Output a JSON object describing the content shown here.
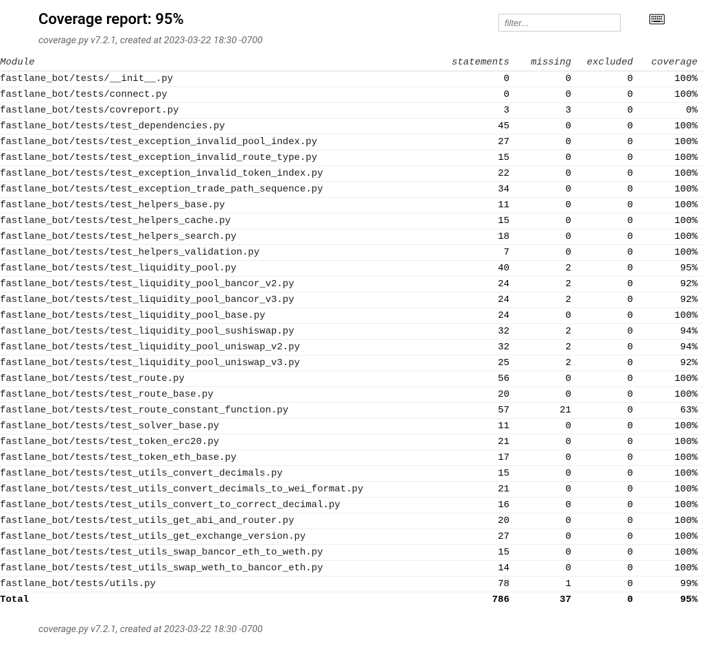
{
  "header": {
    "title_prefix": "Coverage report:",
    "title_pct": "95%",
    "subtitle": "coverage.py v7.2.1, created at 2023-03-22 18:30 -0700",
    "filter_placeholder": "filter..."
  },
  "columns": {
    "module": "Module",
    "statements": "statements",
    "missing": "missing",
    "excluded": "excluded",
    "coverage": "coverage"
  },
  "rows": [
    {
      "name": "fastlane_bot/tests/__init__.py",
      "stmts": "0",
      "miss": "0",
      "excl": "0",
      "cov": "100%"
    },
    {
      "name": "fastlane_bot/tests/connect.py",
      "stmts": "0",
      "miss": "0",
      "excl": "0",
      "cov": "100%"
    },
    {
      "name": "fastlane_bot/tests/covreport.py",
      "stmts": "3",
      "miss": "3",
      "excl": "0",
      "cov": "0%"
    },
    {
      "name": "fastlane_bot/tests/test_dependencies.py",
      "stmts": "45",
      "miss": "0",
      "excl": "0",
      "cov": "100%"
    },
    {
      "name": "fastlane_bot/tests/test_exception_invalid_pool_index.py",
      "stmts": "27",
      "miss": "0",
      "excl": "0",
      "cov": "100%"
    },
    {
      "name": "fastlane_bot/tests/test_exception_invalid_route_type.py",
      "stmts": "15",
      "miss": "0",
      "excl": "0",
      "cov": "100%"
    },
    {
      "name": "fastlane_bot/tests/test_exception_invalid_token_index.py",
      "stmts": "22",
      "miss": "0",
      "excl": "0",
      "cov": "100%"
    },
    {
      "name": "fastlane_bot/tests/test_exception_trade_path_sequence.py",
      "stmts": "34",
      "miss": "0",
      "excl": "0",
      "cov": "100%"
    },
    {
      "name": "fastlane_bot/tests/test_helpers_base.py",
      "stmts": "11",
      "miss": "0",
      "excl": "0",
      "cov": "100%"
    },
    {
      "name": "fastlane_bot/tests/test_helpers_cache.py",
      "stmts": "15",
      "miss": "0",
      "excl": "0",
      "cov": "100%"
    },
    {
      "name": "fastlane_bot/tests/test_helpers_search.py",
      "stmts": "18",
      "miss": "0",
      "excl": "0",
      "cov": "100%"
    },
    {
      "name": "fastlane_bot/tests/test_helpers_validation.py",
      "stmts": "7",
      "miss": "0",
      "excl": "0",
      "cov": "100%"
    },
    {
      "name": "fastlane_bot/tests/test_liquidity_pool.py",
      "stmts": "40",
      "miss": "2",
      "excl": "0",
      "cov": "95%"
    },
    {
      "name": "fastlane_bot/tests/test_liquidity_pool_bancor_v2.py",
      "stmts": "24",
      "miss": "2",
      "excl": "0",
      "cov": "92%"
    },
    {
      "name": "fastlane_bot/tests/test_liquidity_pool_bancor_v3.py",
      "stmts": "24",
      "miss": "2",
      "excl": "0",
      "cov": "92%"
    },
    {
      "name": "fastlane_bot/tests/test_liquidity_pool_base.py",
      "stmts": "24",
      "miss": "0",
      "excl": "0",
      "cov": "100%"
    },
    {
      "name": "fastlane_bot/tests/test_liquidity_pool_sushiswap.py",
      "stmts": "32",
      "miss": "2",
      "excl": "0",
      "cov": "94%"
    },
    {
      "name": "fastlane_bot/tests/test_liquidity_pool_uniswap_v2.py",
      "stmts": "32",
      "miss": "2",
      "excl": "0",
      "cov": "94%"
    },
    {
      "name": "fastlane_bot/tests/test_liquidity_pool_uniswap_v3.py",
      "stmts": "25",
      "miss": "2",
      "excl": "0",
      "cov": "92%"
    },
    {
      "name": "fastlane_bot/tests/test_route.py",
      "stmts": "56",
      "miss": "0",
      "excl": "0",
      "cov": "100%"
    },
    {
      "name": "fastlane_bot/tests/test_route_base.py",
      "stmts": "20",
      "miss": "0",
      "excl": "0",
      "cov": "100%"
    },
    {
      "name": "fastlane_bot/tests/test_route_constant_function.py",
      "stmts": "57",
      "miss": "21",
      "excl": "0",
      "cov": "63%"
    },
    {
      "name": "fastlane_bot/tests/test_solver_base.py",
      "stmts": "11",
      "miss": "0",
      "excl": "0",
      "cov": "100%"
    },
    {
      "name": "fastlane_bot/tests/test_token_erc20.py",
      "stmts": "21",
      "miss": "0",
      "excl": "0",
      "cov": "100%"
    },
    {
      "name": "fastlane_bot/tests/test_token_eth_base.py",
      "stmts": "17",
      "miss": "0",
      "excl": "0",
      "cov": "100%"
    },
    {
      "name": "fastlane_bot/tests/test_utils_convert_decimals.py",
      "stmts": "15",
      "miss": "0",
      "excl": "0",
      "cov": "100%"
    },
    {
      "name": "fastlane_bot/tests/test_utils_convert_decimals_to_wei_format.py",
      "stmts": "21",
      "miss": "0",
      "excl": "0",
      "cov": "100%"
    },
    {
      "name": "fastlane_bot/tests/test_utils_convert_to_correct_decimal.py",
      "stmts": "16",
      "miss": "0",
      "excl": "0",
      "cov": "100%"
    },
    {
      "name": "fastlane_bot/tests/test_utils_get_abi_and_router.py",
      "stmts": "20",
      "miss": "0",
      "excl": "0",
      "cov": "100%"
    },
    {
      "name": "fastlane_bot/tests/test_utils_get_exchange_version.py",
      "stmts": "27",
      "miss": "0",
      "excl": "0",
      "cov": "100%"
    },
    {
      "name": "fastlane_bot/tests/test_utils_swap_bancor_eth_to_weth.py",
      "stmts": "15",
      "miss": "0",
      "excl": "0",
      "cov": "100%"
    },
    {
      "name": "fastlane_bot/tests/test_utils_swap_weth_to_bancor_eth.py",
      "stmts": "14",
      "miss": "0",
      "excl": "0",
      "cov": "100%"
    },
    {
      "name": "fastlane_bot/tests/utils.py",
      "stmts": "78",
      "miss": "1",
      "excl": "0",
      "cov": "99%"
    }
  ],
  "total": {
    "label": "Total",
    "stmts": "786",
    "miss": "37",
    "excl": "0",
    "cov": "95%"
  },
  "footer": {
    "text": "coverage.py v7.2.1, created at 2023-03-22 18:30 -0700"
  }
}
